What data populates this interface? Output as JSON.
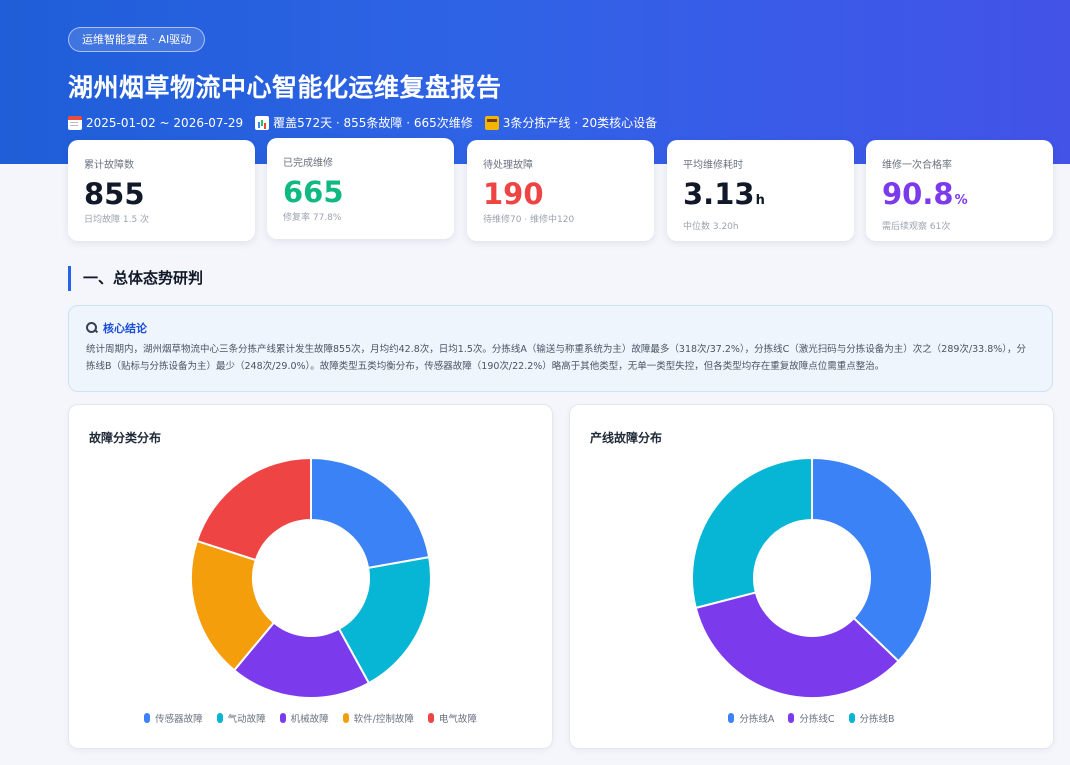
{
  "header": {
    "pill": "运维智能复盘 · AI驱动",
    "title": "湖州烟草物流中心智能化运维复盘报告",
    "meta": [
      {
        "icon": "calendar-icon",
        "text": "2025-01-02 ~ 2026-07-29"
      },
      {
        "icon": "bar-chart-icon",
        "text": "覆盖572天 · 855条故障 · 665次维修"
      },
      {
        "icon": "factory-icon",
        "text": "3条分拣产线 · 20类核心设备"
      }
    ]
  },
  "kpis": [
    {
      "label": "累计故障数",
      "value": "855",
      "unit": "",
      "sub": "日均故障 1.5 次",
      "color": "#111827"
    },
    {
      "label": "已完成维修",
      "value": "665",
      "unit": "",
      "sub": "修复率 77.8%",
      "color": "#10b981"
    },
    {
      "label": "待处理故障",
      "value": "190",
      "unit": "",
      "sub": "待维修70 · 维修中120",
      "color": "#ef4444"
    },
    {
      "label": "平均维修耗时",
      "value": "3.13",
      "unit": "h",
      "sub": "中位数 3.20h",
      "color": "#111827"
    },
    {
      "label": "维修一次合格率",
      "value": "90.8",
      "unit": "%",
      "sub": "需后续观察 61次",
      "color": "#7c3aed"
    }
  ],
  "section": {
    "title": "一、总体态势研判"
  },
  "conclusion": {
    "title": "核心结论",
    "text": "统计周期内，湖州烟草物流中心三条分拣产线累计发生故障855次，月均约42.8次，日均1.5次。分拣线A（输送与称重系统为主）故障最多（318次/37.2%），分拣线C（激光扫码与分拣设备为主）次之（289次/33.8%），分拣线B（贴标与分拣设备为主）最少（248次/29.0%）。故障类型五类均衡分布，传感器故障（190次/22.2%）略高于其他类型，无单一类型失控，但各类型均存在重复故障点位需重点整治。"
  },
  "chart_data": [
    {
      "type": "pie",
      "title": "故障分类分布",
      "categories": [
        "传感器故障",
        "气动故障",
        "机械故障",
        "软件/控制故障",
        "电气故障"
      ],
      "values": [
        190,
        169,
        163,
        162,
        171
      ],
      "colors": [
        "#3b82f6",
        "#06b6d4",
        "#7c3aed",
        "#f59e0b",
        "#ef4444"
      ],
      "legend": "bottom"
    },
    {
      "type": "pie",
      "title": "产线故障分布",
      "categories": [
        "分拣线A",
        "分拣线C",
        "分拣线B"
      ],
      "values": [
        318,
        289,
        248
      ],
      "colors": [
        "#3b82f6",
        "#7c3aed",
        "#06b6d4"
      ],
      "legend": "bottom"
    }
  ]
}
